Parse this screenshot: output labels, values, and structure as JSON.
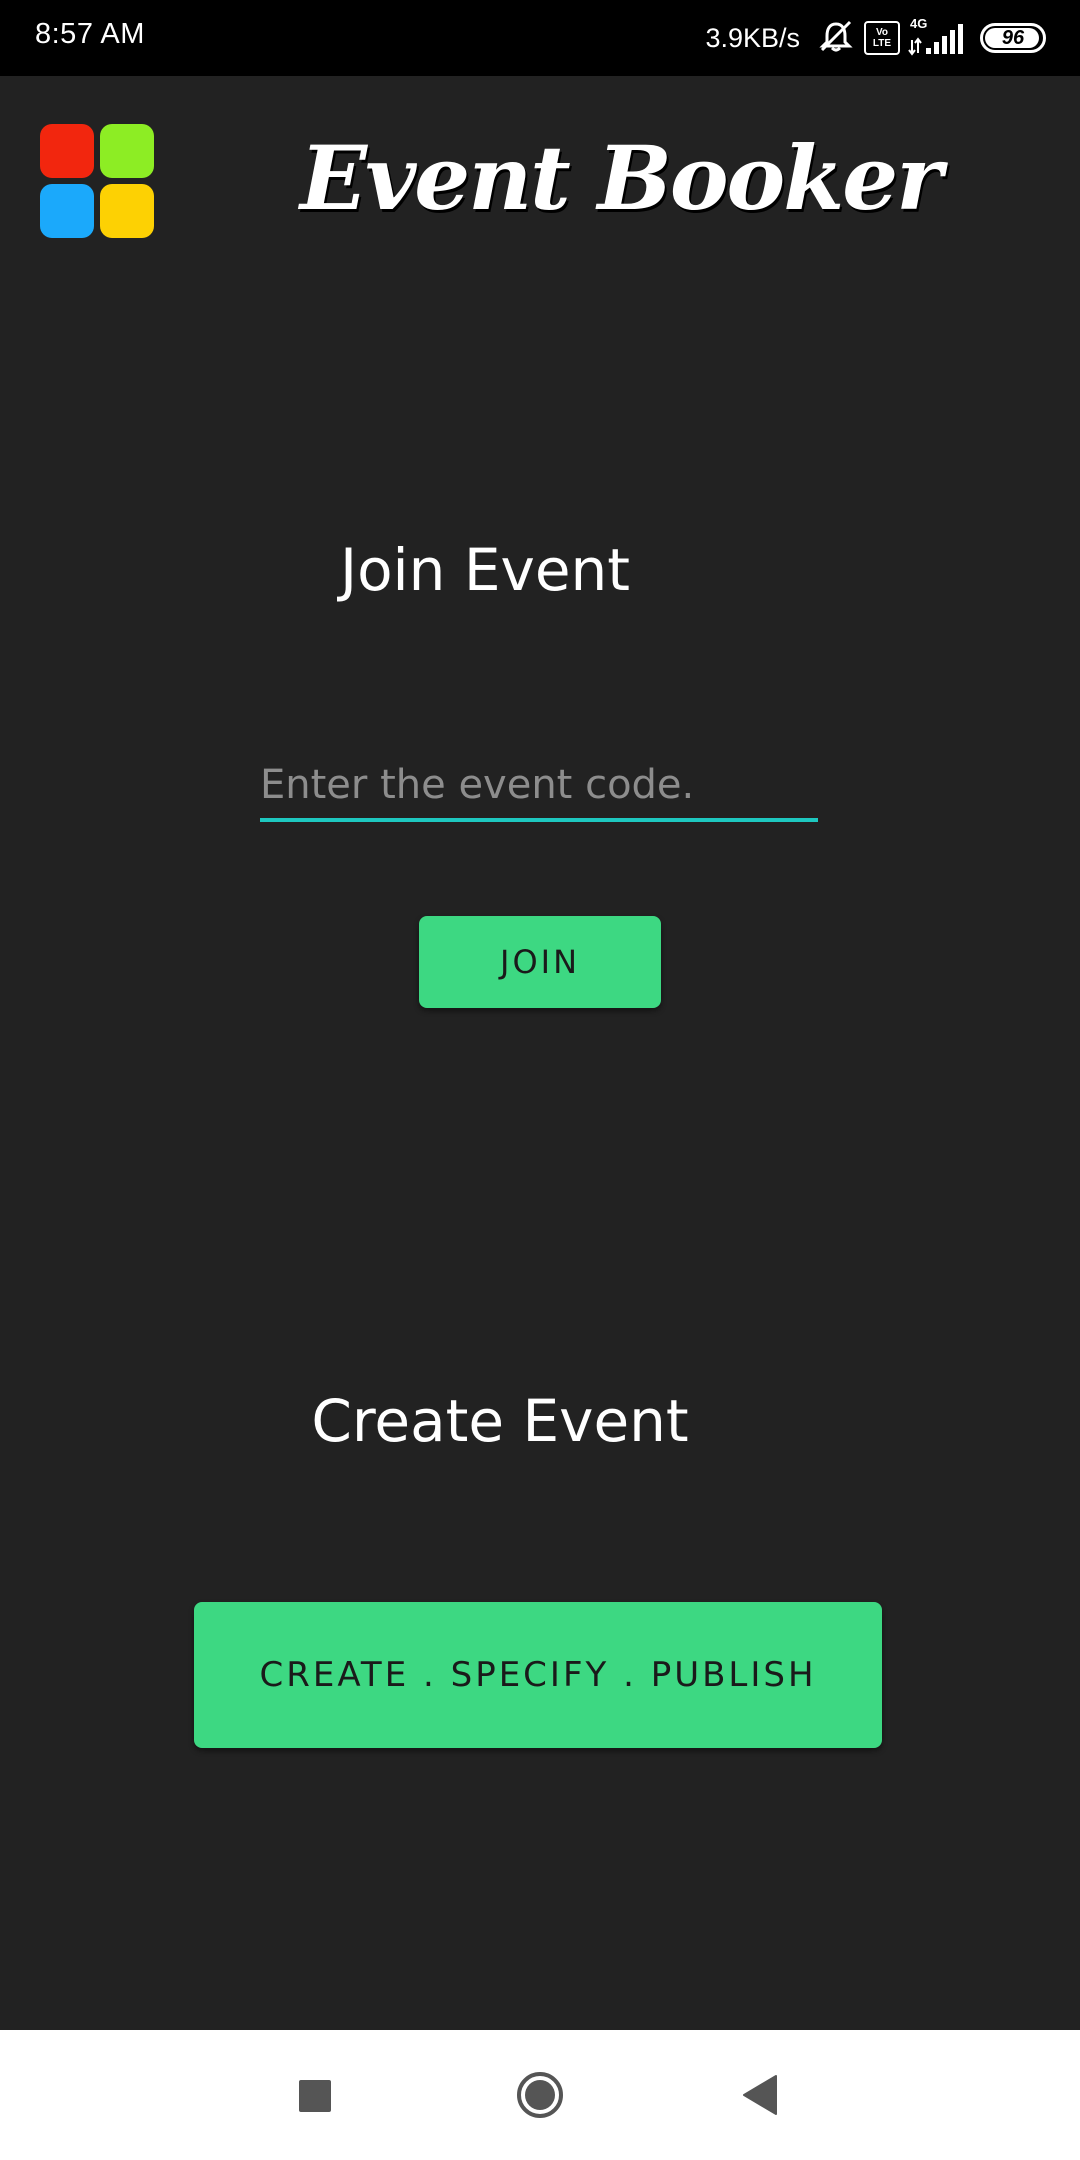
{
  "status_bar": {
    "time": "8:57 AM",
    "net_speed": "3.9KB/s",
    "volte_top": "Vo",
    "volte_bottom": "LTE",
    "network": "4G",
    "battery_level": "96",
    "battery_fraction": 0.96
  },
  "header": {
    "app_title": "Event Booker",
    "logo_colors": [
      "#f2260e",
      "#8ded24",
      "#1ba9fb",
      "#fdd103"
    ]
  },
  "join_section": {
    "heading": "Join Event",
    "input_placeholder": "Enter the event code.",
    "input_value": "",
    "button_label": "JOIN"
  },
  "create_section": {
    "heading": "Create Event",
    "button_label": "CREATE . SPECIFY . PUBLISH"
  },
  "colors": {
    "background": "#222222",
    "accent_button": "#3dd882",
    "input_underline": "#1ec8c0"
  }
}
